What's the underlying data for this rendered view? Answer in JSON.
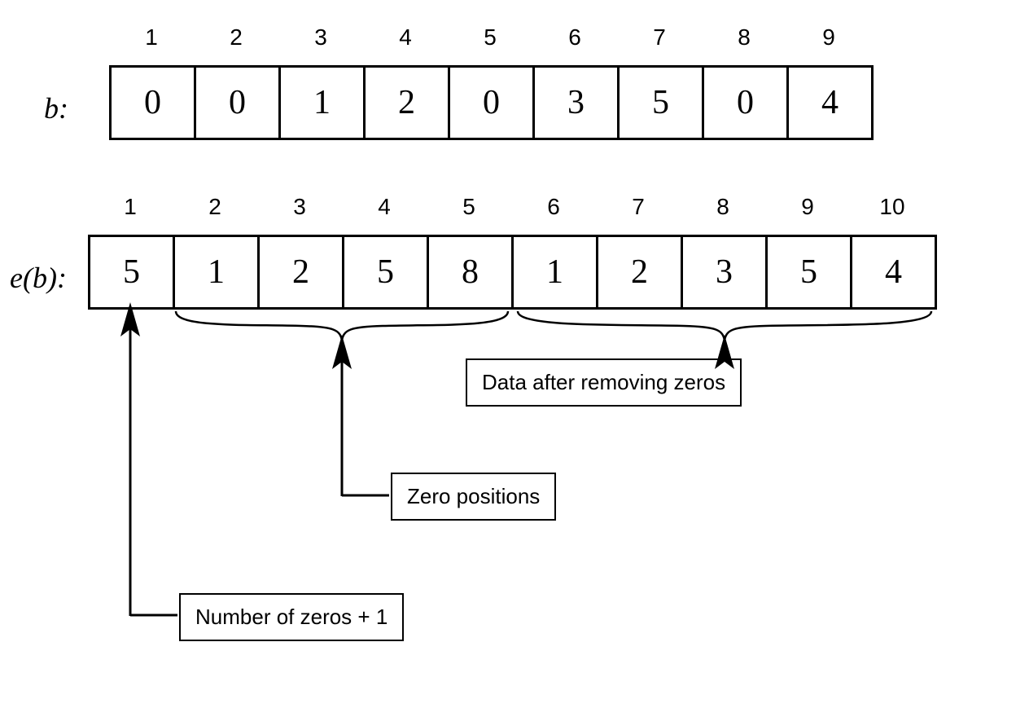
{
  "labels": {
    "b": "b:",
    "eb": "e(b):"
  },
  "b_array": {
    "indices": [
      "1",
      "2",
      "3",
      "4",
      "5",
      "6",
      "7",
      "8",
      "9"
    ],
    "values": [
      "0",
      "0",
      "1",
      "2",
      "0",
      "3",
      "5",
      "0",
      "4"
    ]
  },
  "eb_array": {
    "indices": [
      "1",
      "2",
      "3",
      "4",
      "5",
      "6",
      "7",
      "8",
      "9",
      "10"
    ],
    "values": [
      "5",
      "1",
      "2",
      "5",
      "8",
      "1",
      "2",
      "3",
      "5",
      "4"
    ]
  },
  "annotations": {
    "num_zeros": "Number of zeros + 1",
    "zero_positions": "Zero positions",
    "data_after": "Data after removing zeros"
  }
}
